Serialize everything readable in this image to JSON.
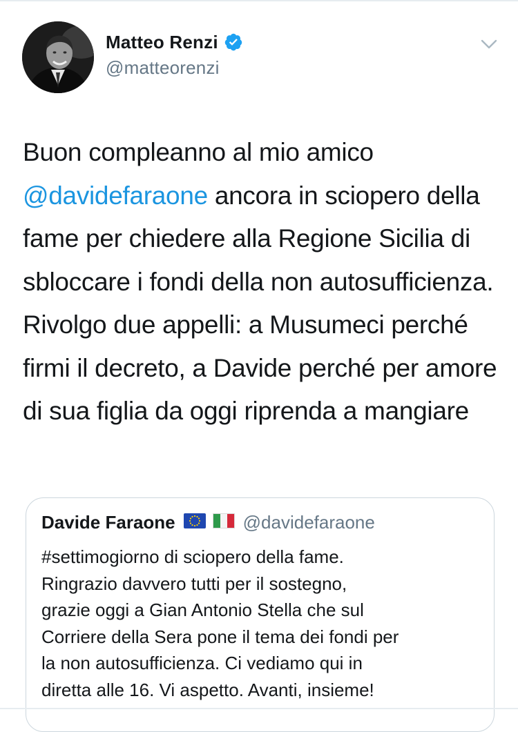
{
  "tweet": {
    "author": {
      "display_name": "Matteo Renzi",
      "handle": "@matteorenzi",
      "verified": true
    },
    "text_parts": {
      "before_mention": "Buon compleanno al mio amico ",
      "mention": "@davidefaraone",
      "after_mention": " ancora in sciopero della fame per chiedere alla Regione Sicilia di sbloccare i fondi della non autosufficienza. Rivolgo due appelli: a Musumeci perché firmi il decreto, a Davide perché per amore di sua figlia da oggi riprenda a mangiare"
    },
    "quoted_tweet": {
      "author": {
        "display_name": "Davide Faraone",
        "handle": "@davidefaraone",
        "flags": [
          "eu-flag-icon",
          "italy-flag-icon"
        ]
      },
      "text": "#settimogiorno di sciopero della fame.\nRingrazio davvero tutti per il sostegno,\ngrazie oggi a Gian Antonio Stella che sul\nCorriere della Sera pone il tema dei fondi per\nla non autosufficienza. Ci vediamo qui in\ndiretta alle 16. Vi aspetto. Avanti, insieme!"
    }
  },
  "colors": {
    "text_primary": "#14171a",
    "text_secondary": "#657786",
    "link": "#1b95e0",
    "verified_badge": "#1da1f2",
    "border": "#ccd6dd",
    "divider": "#e6ecf0"
  }
}
